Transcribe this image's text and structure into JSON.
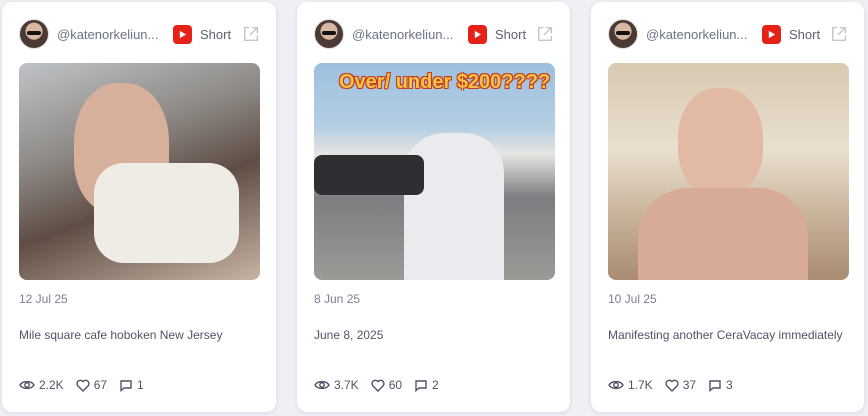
{
  "cards": [
    {
      "handle": "@katenorkeliun...",
      "type_label": "Short",
      "overlay": "",
      "date": "12 Jul 25",
      "caption": "Mile square cafe hoboken New Jersey",
      "views": "2.2K",
      "likes": "67",
      "comments": "1"
    },
    {
      "handle": "@katenorkeliun...",
      "type_label": "Short",
      "overlay": "Over/ under $200????",
      "date": "8 Jun 25",
      "caption": "June 8, 2025",
      "views": "3.7K",
      "likes": "60",
      "comments": "2"
    },
    {
      "handle": "@katenorkeliun...",
      "type_label": "Short",
      "overlay": "",
      "date": "10 Jul 25",
      "caption": "Manifesting another CeraVacay immediately",
      "views": "1.7K",
      "likes": "37",
      "comments": "3"
    }
  ],
  "colors": {
    "youtube_red": "#e62117",
    "card_bg": "#ffffff",
    "page_bg": "#eef0f5"
  },
  "icons": [
    "youtube-icon",
    "external-link-icon",
    "eye-icon",
    "heart-icon",
    "comment-icon"
  ]
}
